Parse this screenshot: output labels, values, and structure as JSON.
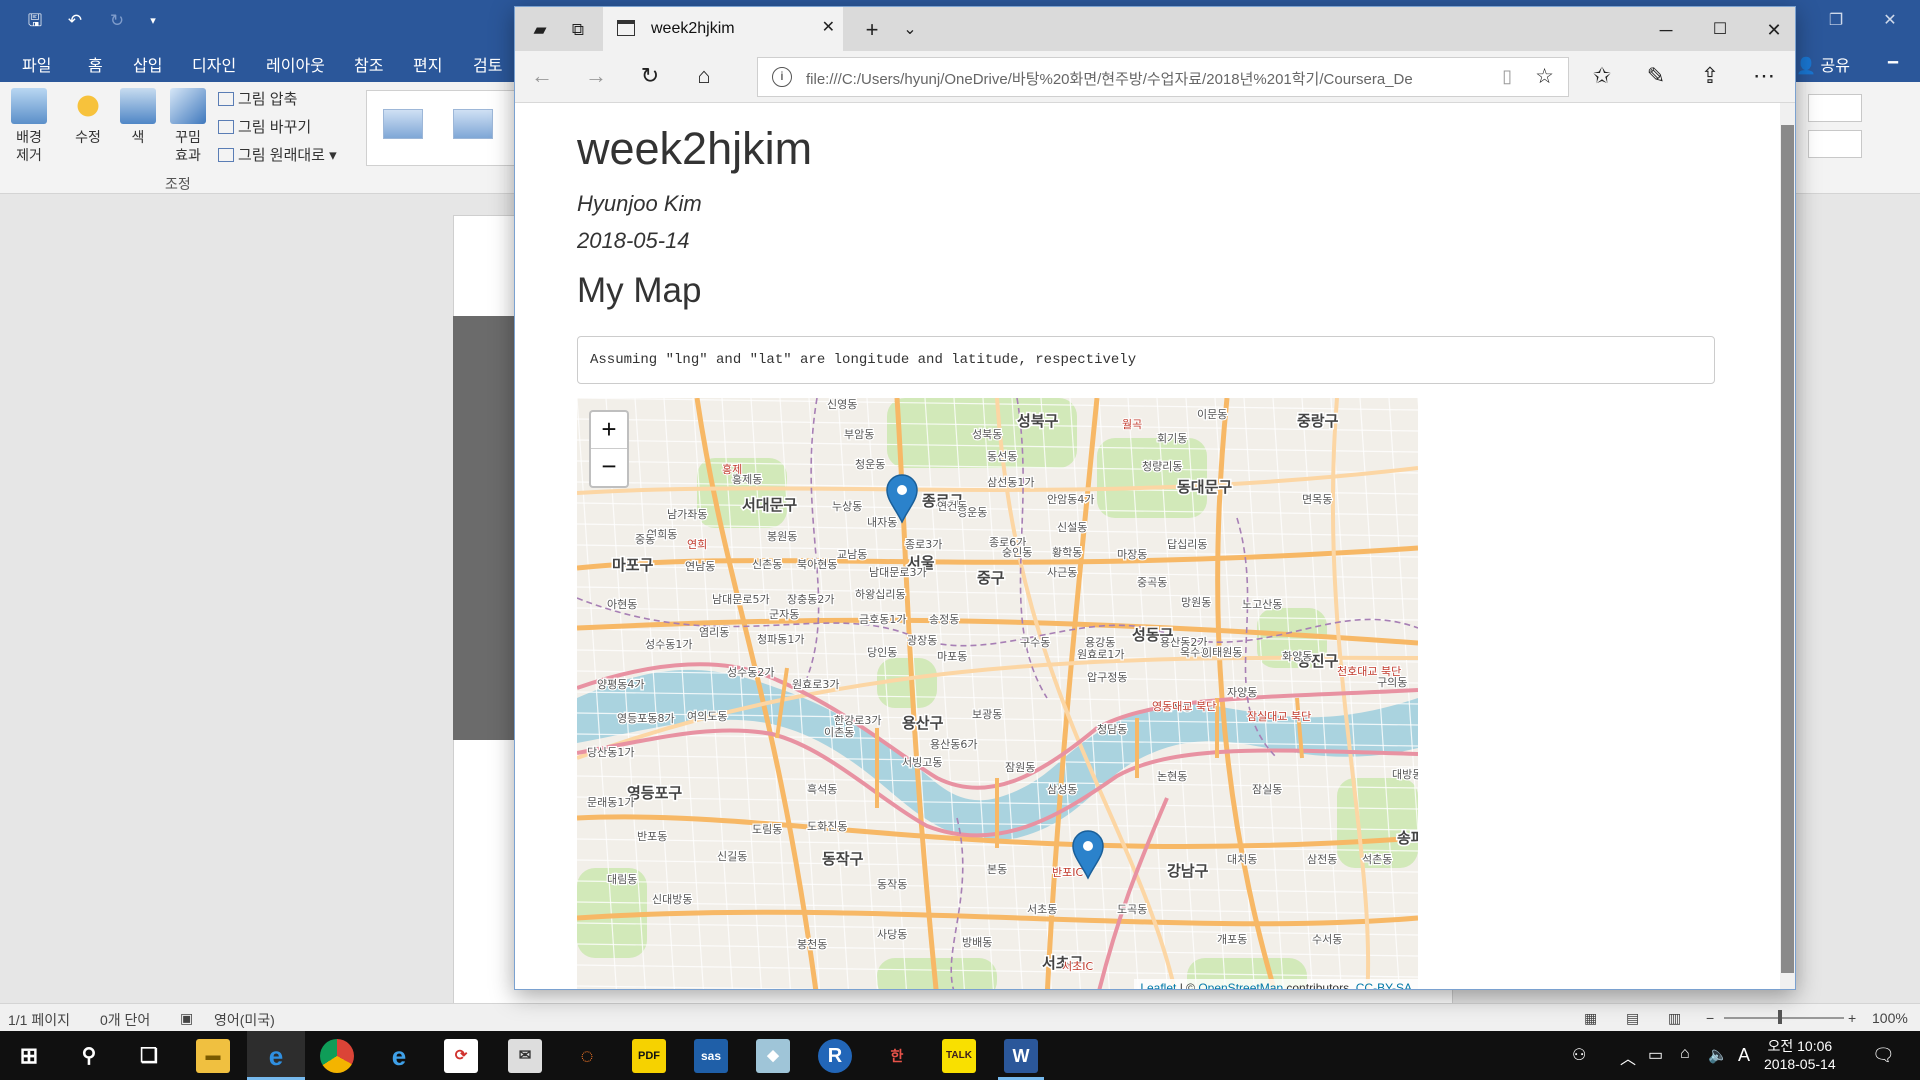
{
  "word": {
    "ribbon_tabs": [
      "파일",
      "홈",
      "삽입",
      "디자인",
      "레이아웃",
      "참조",
      "편지",
      "검토"
    ],
    "share_label": "공유",
    "ribbon_buttons": {
      "remove_bg": "배경\n제거",
      "corrections": "수정",
      "color": "색",
      "artistic": "꾸밈\n효과",
      "compress": "그림 압축",
      "change": "그림 바꾸기",
      "reset": "그림 원래대로",
      "group_label": "조정"
    },
    "status": {
      "page": "1/1 페이지",
      "words": "0개 단어",
      "language": "영어(미국)",
      "zoom": "100%"
    }
  },
  "edge": {
    "tab_title": "week2hjkim",
    "address": "file:///C:/Users/hyunj/OneDrive/바탕%20화면/현주방/수업자료/2018년%201학기/Coursera_De"
  },
  "doc": {
    "title": "week2hjkim",
    "author": "Hyunjoo Kim",
    "date": "2018-05-14",
    "section_heading": "My Map",
    "code_output": "Assuming \"lng\" and \"lat\" are longitude and latitude, respectively"
  },
  "map": {
    "zoom_in": "+",
    "zoom_out": "−",
    "attribution": {
      "leaflet": "Leaflet",
      "sep": " | © ",
      "osm": "OpenStreetMap",
      "contributors": " contributors, ",
      "license": "CC-BY-SA"
    },
    "marker_color": "#2b82cb",
    "district_labels": [
      {
        "text": "성북구",
        "big": true
      },
      {
        "text": "중랑구",
        "big": true
      },
      {
        "text": "동대문구",
        "big": true
      },
      {
        "text": "서대문구",
        "big": true
      },
      {
        "text": "종로구",
        "big": true
      },
      {
        "text": "마포구",
        "big": true
      },
      {
        "text": "서울",
        "big": true
      },
      {
        "text": "중구",
        "big": true
      },
      {
        "text": "성동구",
        "big": true
      },
      {
        "text": "광진구",
        "big": true
      },
      {
        "text": "용산구",
        "big": true
      },
      {
        "text": "영등포구",
        "big": true
      },
      {
        "text": "동작구",
        "big": true
      },
      {
        "text": "강남구",
        "big": true
      },
      {
        "text": "서초구",
        "big": true
      },
      {
        "text": "송파",
        "big": true
      }
    ],
    "small_labels": [
      "신영동",
      "부암동",
      "청운동",
      "성북동",
      "동선동",
      "삼선동1가",
      "이문동",
      "회기동",
      "청량리동",
      "홍제동",
      "누상동",
      "내자동",
      "경운동",
      "연건동",
      "안암동4가",
      "신설동",
      "면목동",
      "남가좌동",
      "연희동",
      "봉원동",
      "종로3가",
      "종로6가",
      "답십리동",
      "중동",
      "교남동",
      "숭인동",
      "황학동",
      "마장동",
      "연남동",
      "신촌동",
      "북아현동",
      "남대문로3가",
      "하왕십리동",
      "사근동",
      "중곡동",
      "망원동",
      "노고산동",
      "아현동",
      "남대문로5가",
      "장충동2가",
      "금호동1가",
      "송정동",
      "군자동",
      "염리동",
      "청파동1가",
      "광장동",
      "구수동",
      "용강동",
      "용산동2가",
      "옥수동",
      "성수동1가",
      "성수동2가",
      "당인동",
      "마포동",
      "원효로1가",
      "이태원동",
      "화양동",
      "양평동4가",
      "원효로3가",
      "압구정동",
      "자양동",
      "구의동",
      "영등포동8가",
      "여의도동",
      "한강로3가",
      "보광동",
      "신사동",
      "청담동",
      "당산동1가",
      "이촌동",
      "용산동6가",
      "서빙고동",
      "잠원동",
      "논현동",
      "삼성동",
      "잠실동",
      "문래동1가",
      "도림동",
      "도화진동",
      "본동",
      "반포동",
      "신길동",
      "대방동",
      "흑석동",
      "대치동",
      "삼전동",
      "석촌동",
      "대림동",
      "신대방동",
      "동작동",
      "서초동",
      "도곡동",
      "사당동",
      "봉천동",
      "방배동",
      "개포동",
      "수서동"
    ],
    "road_labels": [
      "영동대교 북단",
      "잠실대교 북단",
      "천호대교 북단",
      "반포IC",
      "서초IC",
      "연희",
      "홍제",
      "월곡"
    ]
  }
}
